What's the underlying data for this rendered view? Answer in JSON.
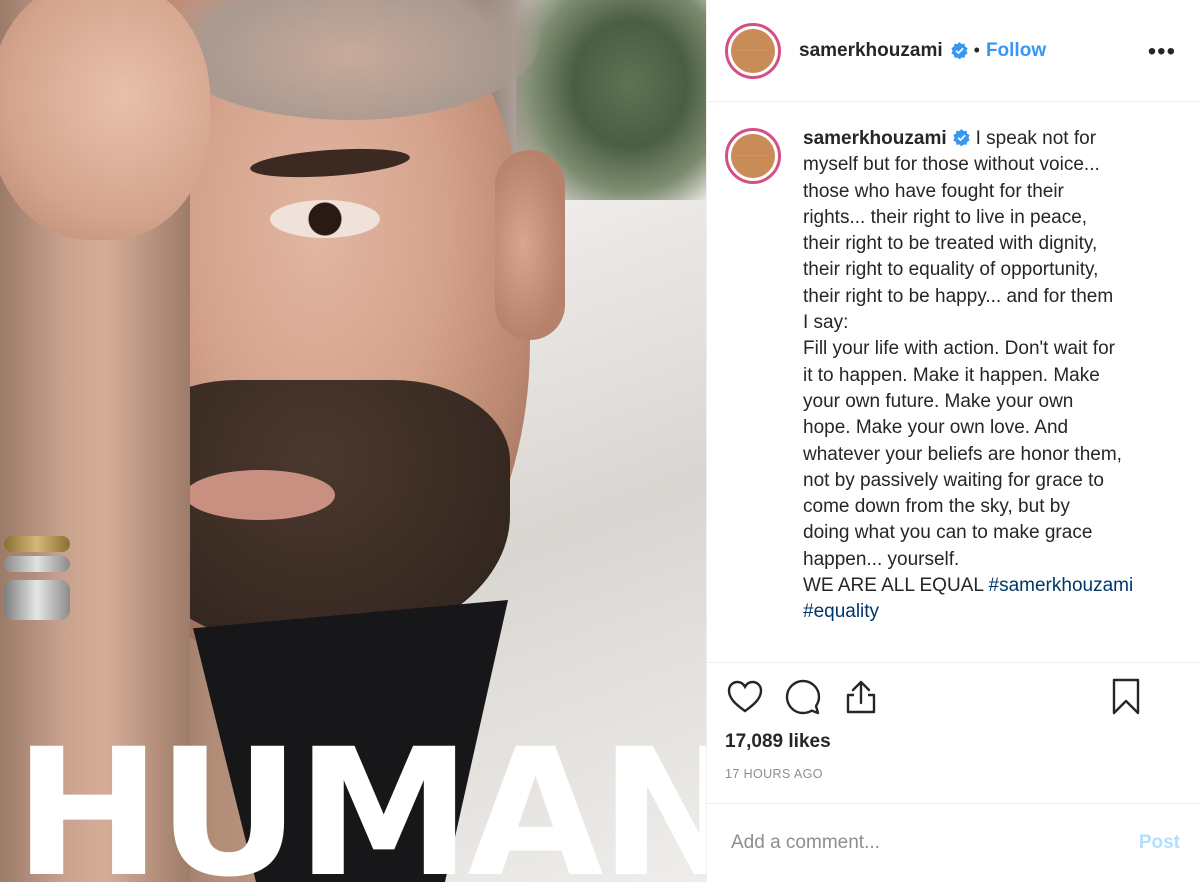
{
  "photo": {
    "overlay_text": "HUMAN"
  },
  "header": {
    "username": "samerkhouzami",
    "separator": "•",
    "follow_label": "Follow",
    "more_label": "•••",
    "verified_icon": "verified-badge-icon"
  },
  "caption": {
    "username": "samerkhouzami",
    "lines": [
      "I speak not for",
      "myself but for those without voice...",
      "those who have fought for their",
      "rights... their right to live in peace,",
      "their right to be treated with dignity,",
      "their right to equality of opportunity,",
      "their right to be happy... and for them",
      "I say:",
      "Fill your life with action. Don't wait for",
      "it to happen. Make it happen. Make",
      "your own future. Make your own",
      "hope. Make your own love. And",
      "whatever your beliefs are honor them,",
      "not by passively waiting for grace to",
      "come down from the sky, but by",
      "doing what you can to make grace",
      "happen... yourself."
    ],
    "last_line_text": "WE ARE ALL EQUAL",
    "hashtag1": "#samerkhouzami",
    "hashtag2": "#equality"
  },
  "actions": {
    "icons": [
      "heart-icon",
      "comment-icon",
      "share-icon",
      "bookmark-icon"
    ],
    "likes": "17,089 likes",
    "timestamp": "17 HOURS AGO"
  },
  "comment_box": {
    "placeholder": "Add a comment...",
    "post_label": "Post"
  },
  "colors": {
    "accent": "#3897f0",
    "hashtag": "#003569",
    "post_disabled": "#b2dffc",
    "avatar_ring": "#d64f83",
    "avatar_fill": "#c98c59"
  }
}
